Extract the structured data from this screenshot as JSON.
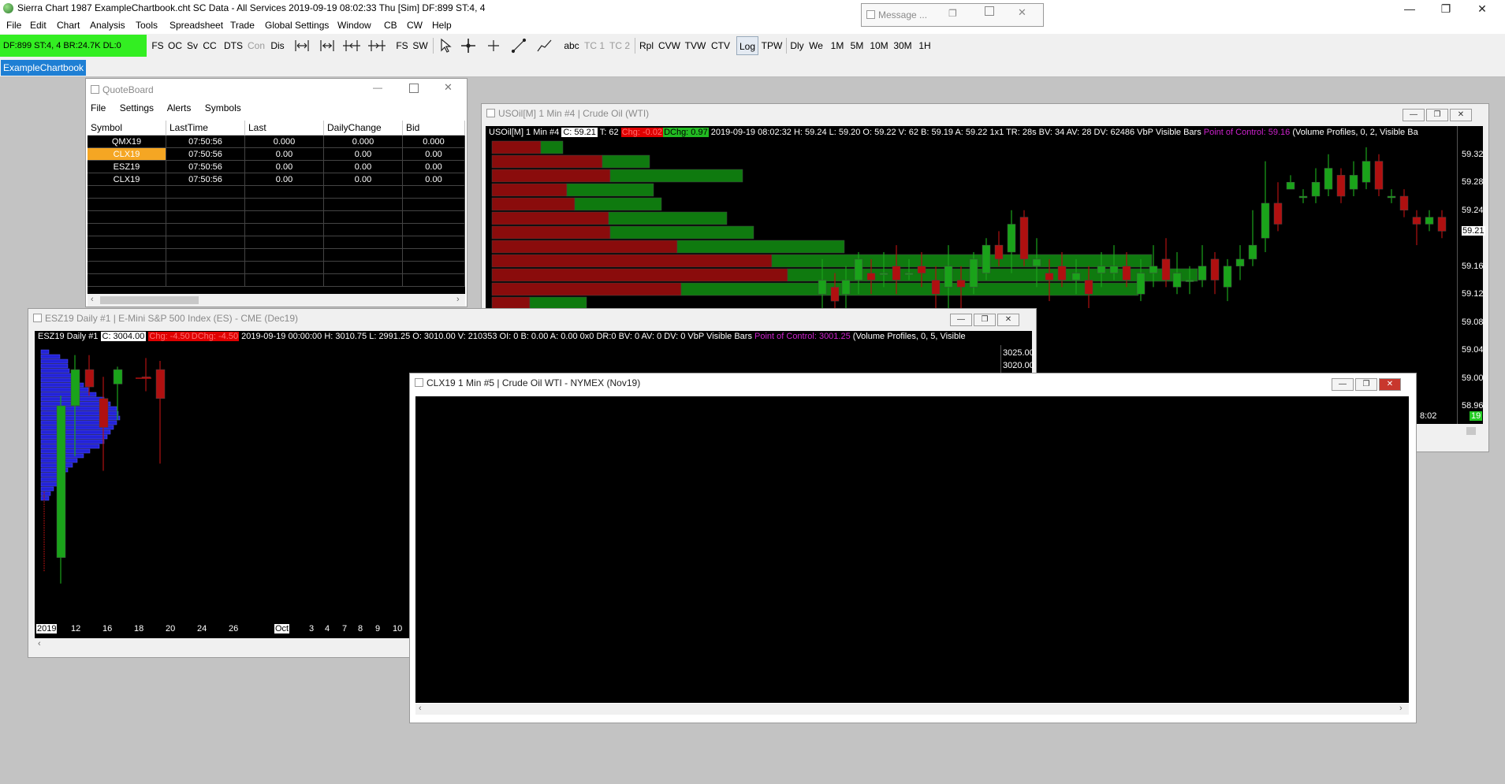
{
  "app": {
    "title": "Sierra Chart 1987 ExampleChartbook.cht  SC Data - All Services 2019-09-19  08:02:33 Thu [Sim]  DF:899  ST:4, 4",
    "min_glyph": "—",
    "restore_glyph": "❐",
    "close_glyph": "✕"
  },
  "menu": [
    "File",
    "Edit",
    "Chart",
    "Analysis",
    "Tools",
    "Spreadsheet",
    "Trade",
    "Global Settings",
    "Window",
    "CB",
    "CW",
    "Help"
  ],
  "message_window": {
    "title": "Message ..."
  },
  "status": {
    "text": "DF:899  ST:4, 4   BR:24.7K  DL:0",
    "color": "#33ee22"
  },
  "toolbar": {
    "b1": "FS",
    "b2": "OC",
    "b3": "Sv",
    "b4": "CC",
    "b5": "DTS",
    "b6": "Con",
    "b7": "Dis",
    "abc": "abc",
    "tc1": "TC 1",
    "tc2": "TC 2",
    "rpl": "Rpl",
    "cvw": "CVW",
    "tvw": "TVW",
    "ctv": "CTV",
    "log": "Log",
    "tpw": "TPW",
    "dly": "Dly",
    "we": "We",
    "m1": "1M",
    "m5": "5M",
    "m10": "10M",
    "m30": "30M",
    "h1": "1H"
  },
  "chartbook_tab": "ExampleChartbook",
  "quoteboard": {
    "title": "QuoteBoard",
    "menu": [
      "File",
      "Settings",
      "Alerts",
      "Symbols"
    ],
    "columns": [
      "Symbol",
      "LastTime",
      "Last",
      "DailyChange",
      "Bid"
    ],
    "rows": [
      [
        "QMX19",
        "07:50:56",
        "0.000",
        "0.000",
        "0.000"
      ],
      [
        "CLX19",
        "07:50:56",
        "0.00",
        "0.00",
        "0.00"
      ],
      [
        "ESZ19",
        "07:50:56",
        "0.00",
        "0.00",
        "0.00"
      ],
      [
        "CLX19",
        "07:50:56",
        "0.00",
        "0.00",
        "0.00"
      ]
    ],
    "highlight_color": "#f5a623"
  },
  "usoil": {
    "title": "USOil[M]  1 Min   #4 | Crude Oil (WTI)",
    "info_sym": "USOil[M]   1 Min   #4",
    "close": "C: 59.21",
    "trades": "T: 62",
    "chg": "Chg: -0.02",
    "dchg": "DChg: 0.97",
    "rest": "2019-09-19 08:02:32 H: 59.24 L: 59.20 O: 59.22 V: 62 B: 59.19 A: 59.22 1x1 TR: 28s BV: 34 AV: 28 DV: 62486 VbP Visible Bars",
    "poc": "Point of Control: 59.16",
    "vp": "(Volume Profiles, 0, 2, Visible Ba",
    "price_labels": [
      "59.32",
      "59.28",
      "59.24",
      "59.21",
      "59.16",
      "59.12",
      "59.08",
      "59.04",
      "59.00",
      "58.96"
    ],
    "last_price": "59.21",
    "time_label": "8:02",
    "bar_count": "19"
  },
  "esz19": {
    "title": "ESZ19  Daily  #1 | E-Mini S&P 500 Index (ES) - CME (Dec19)",
    "info_sym": "ESZ19   Daily   #1",
    "close": "C: 3004.00",
    "chg": "Chg: -4.50",
    "dchg": "DChg: -4.50",
    "rest": "2019-09-19 00:00:00 H: 3010.75 L: 2991.25 O: 3010.00 V: 210353 OI: 0 B: 0.00 A: 0.00 0x0 DR:0 BV: 0 AV: 0 DV: 0 VbP Visible Bars",
    "poc": "Point of Control: 3001.25",
    "vp": "(Volume Profiles, 0, 5, Visible",
    "price_label": "3025.00",
    "price_label2": "3020.00",
    "dates": [
      "2019",
      "12",
      "16",
      "18",
      "20",
      "24",
      "26",
      "Oct",
      "3",
      "4",
      "7",
      "8",
      "9",
      "10"
    ]
  },
  "clx19": {
    "title": "CLX19  1 Min   #5 | Crude Oil WTI - NYMEX (Nov19)"
  },
  "colors": {
    "up": "#1aa31a",
    "down": "#b01010",
    "profile_up": "#0f7a0f",
    "profile_down": "#8a0c0c",
    "poc": "#cc22cc",
    "blue_profile": "#2323d8"
  }
}
